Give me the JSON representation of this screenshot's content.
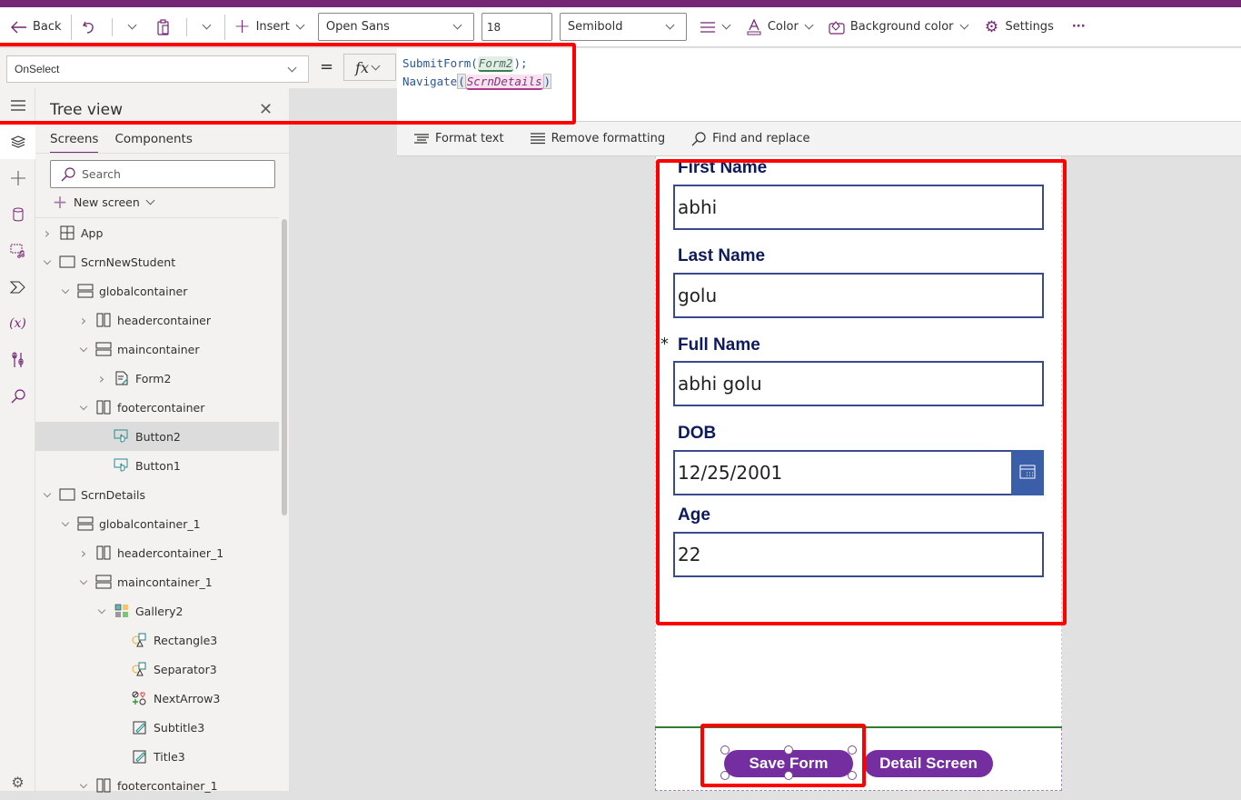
{
  "toolbar": {
    "back_label": "Back",
    "insert_label": "Insert",
    "font_family": "Open Sans",
    "font_size": "18",
    "font_weight": "Semibold",
    "color_label": "Color",
    "background_color_label": "Background color",
    "settings_label": "Settings",
    "more_label": "···"
  },
  "formula_bar": {
    "property": "OnSelect",
    "equals": "=",
    "fx": "fx",
    "line1": {
      "fn": "SubmitForm(",
      "arg": "Form2",
      "tail": ");"
    },
    "line2": {
      "fn": "Navigate",
      "open": "(",
      "arg": "ScrnDetails",
      "close": ")"
    }
  },
  "format_bar": {
    "format_text": "Format text",
    "remove_formatting": "Remove formatting",
    "find_replace": "Find and replace"
  },
  "tree_view": {
    "title": "Tree view",
    "tabs": [
      "Screens",
      "Components"
    ],
    "active_tab": "Screens",
    "search_placeholder": "Search",
    "new_screen_label": "New screen",
    "nodes": [
      {
        "label": "App",
        "depth": 0,
        "icon": "app-icon",
        "toggle": "collapsed"
      },
      {
        "label": "ScrnNewStudent",
        "depth": 0,
        "icon": "screen-icon",
        "toggle": "expanded"
      },
      {
        "label": "globalcontainer",
        "depth": 1,
        "icon": "vertical-container-icon",
        "toggle": "expanded"
      },
      {
        "label": "headercontainer",
        "depth": 2,
        "icon": "horizontal-container-icon",
        "toggle": "collapsed"
      },
      {
        "label": "maincontainer",
        "depth": 2,
        "icon": "vertical-container-icon",
        "toggle": "expanded"
      },
      {
        "label": "Form2",
        "depth": 3,
        "icon": "form-icon",
        "toggle": "collapsed"
      },
      {
        "label": "footercontainer",
        "depth": 2,
        "icon": "horizontal-container-icon",
        "toggle": "expanded"
      },
      {
        "label": "Button2",
        "depth": 3,
        "icon": "button-icon",
        "toggle": "none",
        "selected": true
      },
      {
        "label": "Button1",
        "depth": 3,
        "icon": "button-icon",
        "toggle": "none"
      },
      {
        "label": "ScrnDetails",
        "depth": 0,
        "icon": "screen-icon",
        "toggle": "expanded"
      },
      {
        "label": "globalcontainer_1",
        "depth": 1,
        "icon": "vertical-container-icon",
        "toggle": "expanded"
      },
      {
        "label": "headercontainer_1",
        "depth": 2,
        "icon": "horizontal-container-icon",
        "toggle": "collapsed"
      },
      {
        "label": "maincontainer_1",
        "depth": 2,
        "icon": "vertical-container-icon",
        "toggle": "expanded"
      },
      {
        "label": "Gallery2",
        "depth": 3,
        "icon": "gallery-icon",
        "toggle": "expanded"
      },
      {
        "label": "Rectangle3",
        "depth": 4,
        "icon": "shape-icon",
        "toggle": "none"
      },
      {
        "label": "Separator3",
        "depth": 4,
        "icon": "shape-icon",
        "toggle": "none"
      },
      {
        "label": "NextArrow3",
        "depth": 4,
        "icon": "icons-control-icon",
        "toggle": "none"
      },
      {
        "label": "Subtitle3",
        "depth": 4,
        "icon": "label-edit-icon",
        "toggle": "none"
      },
      {
        "label": "Title3",
        "depth": 4,
        "icon": "label-edit-icon",
        "toggle": "none"
      },
      {
        "label": "footercontainer_1",
        "depth": 2,
        "icon": "horizontal-container-icon",
        "toggle": "expanded"
      }
    ]
  },
  "rail": [
    "menu-icon",
    "layers-icon",
    "insert-icon",
    "data-icon",
    "media-icon",
    "power-automate-icon",
    "variables-icon",
    "advanced-tools-icon",
    "search-icon",
    "settings-icon"
  ],
  "form": {
    "fields": [
      {
        "label": "First Name",
        "value": "abhi",
        "required": false
      },
      {
        "label": "Last Name",
        "value": "golu",
        "required": false
      },
      {
        "label": "Full Name",
        "value": "abhi golu",
        "required": true
      },
      {
        "label": "DOB",
        "value": "12/25/2001",
        "type": "date"
      },
      {
        "label": "Age",
        "value": "22"
      }
    ],
    "required_marker": "*"
  },
  "footer_buttons": {
    "save": "Save Form",
    "detail": "Detail Screen"
  },
  "colors": {
    "brand": "#742774",
    "button": "#742ea0",
    "label": "#0d1a5c",
    "highlight": "#ff0000"
  }
}
